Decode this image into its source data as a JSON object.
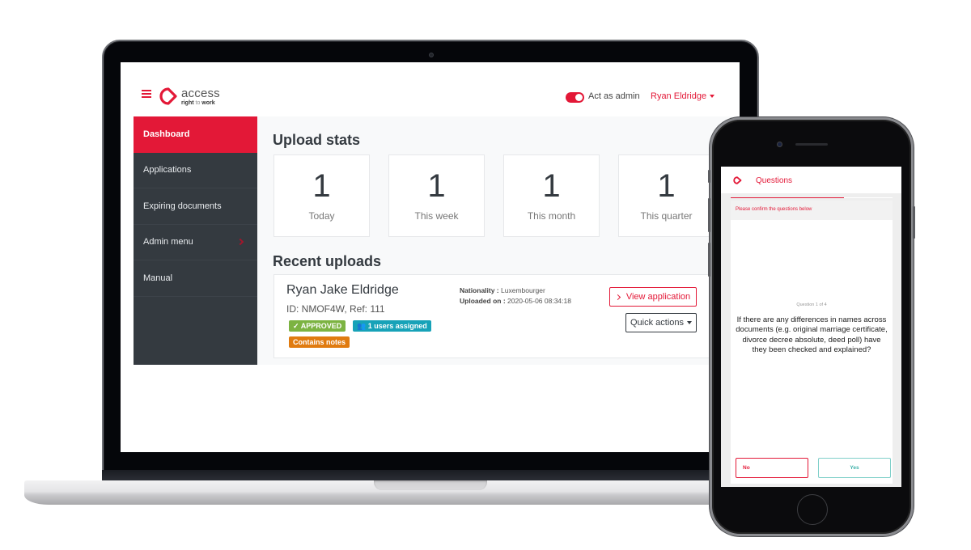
{
  "laptop": {
    "header": {
      "brand_name": "access",
      "brand_tagline_a": "right",
      "brand_tagline_b": " to ",
      "brand_tagline_c": "work",
      "act_as_admin_label": "Act as admin",
      "act_as_admin_on": true,
      "user_name": "Ryan Eldridge"
    },
    "sidebar": {
      "items": [
        {
          "label": "Dashboard",
          "active": true
        },
        {
          "label": "Applications"
        },
        {
          "label": "Expiring documents"
        },
        {
          "label": "Admin menu",
          "has_submenu": true
        },
        {
          "label": "Manual"
        }
      ]
    },
    "upload_stats": {
      "title": "Upload stats",
      "cards": [
        {
          "value": "1",
          "label": "Today"
        },
        {
          "value": "1",
          "label": "This week"
        },
        {
          "value": "1",
          "label": "This month"
        },
        {
          "value": "1",
          "label": "This quarter"
        }
      ]
    },
    "recent_uploads": {
      "title": "Recent uploads",
      "items": [
        {
          "name": "Ryan Jake Eldridge",
          "id_line": "ID: NMOF4W, Ref: 111",
          "status_badge": "✓ APPROVED",
          "users_badge": "1 users assigned",
          "notes_badge": "Contains notes",
          "nationality_label": "Nationality :",
          "nationality_value": "Luxembourger",
          "uploaded_label": "Uploaded on :",
          "uploaded_value": "2020-05-06 08:34:18",
          "view_button": "View application",
          "quick_actions_button": "Quick actions"
        }
      ]
    }
  },
  "phone": {
    "title": "Questions",
    "progress_percent": 70,
    "banner": "Please confirm the questions below",
    "counter": "Question 1 of 4",
    "question": "If there are any differences in names across documents (e.g. original marriage certificate, divorce decree absolute, deed poll) have they been checked and explained?",
    "no_button": "No",
    "yes_button": "Yes"
  },
  "colors": {
    "brand_red": "#e31837",
    "sidebar_dark": "#343a40",
    "approved_green": "#7cb342",
    "users_teal": "#17a2b8",
    "notes_orange": "#e07b10",
    "yes_teal": "#7fcfc9"
  }
}
